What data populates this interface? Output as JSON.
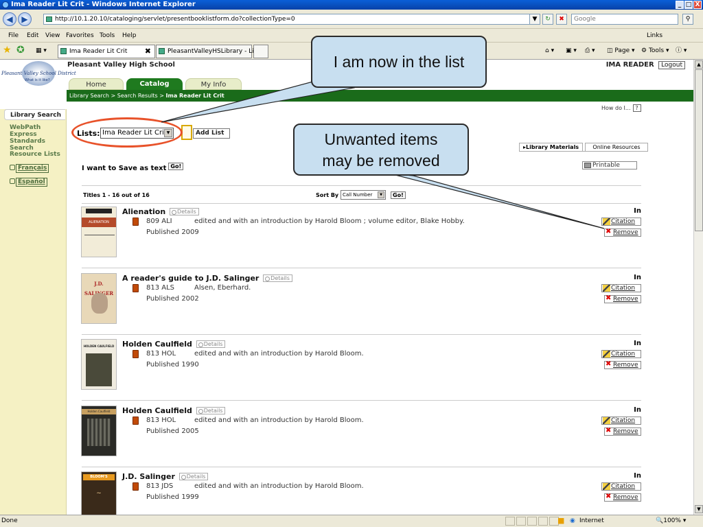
{
  "window": {
    "title": "Ima Reader Lit Crit - Windows Internet Explorer",
    "buttons": [
      "_",
      "□",
      "X"
    ]
  },
  "addressbar": {
    "url": "http://10.1.20.10/cataloging/servlet/presentbooklistform.do?collectionType=0",
    "search_placeholder": "Google"
  },
  "menu": {
    "items": [
      "File",
      "Edit",
      "View",
      "Favorites",
      "Tools",
      "Help"
    ],
    "links": "Links"
  },
  "browser_tabs": [
    {
      "label": "Ima Reader Lit Crit",
      "close": "✖"
    },
    {
      "label": "PleasantValleyHSLibrary - Lit..."
    }
  ],
  "toolbar": {
    "page": "Page",
    "tools": "Tools"
  },
  "status": {
    "left": "Done",
    "zone": "Internet",
    "zoom": "100%"
  },
  "site": {
    "logo_name": "Pleasant Valley School District",
    "logo_sub": "What is it like?",
    "school": "Pleasant Valley High School",
    "user": "IMA READER",
    "logout": "Logout"
  },
  "nav_tabs": [
    "Home",
    "Catalog",
    "My Info"
  ],
  "breadcrumb": {
    "path": "Library Search > Search Results > ",
    "current": "Ima Reader Lit Crit"
  },
  "sidebar": {
    "items": [
      "Library Search",
      "WebPath Express",
      "Standards Search",
      "Resource Lists"
    ],
    "languages": [
      "Français",
      "Español"
    ]
  },
  "help": {
    "label": "How do I...",
    "icon": "?"
  },
  "lists": {
    "label": "Lists:",
    "selected": "Ima Reader Lit Crit",
    "add_button": "Add List"
  },
  "result_tabs": [
    "Library Materials",
    "Online Resources"
  ],
  "save": {
    "label": "I want to Save as text",
    "go": "Go!"
  },
  "printable": "Printable",
  "results": {
    "count": "Titles 1 - 16 out of 16",
    "sort_label": "Sort By",
    "sort_selected": "Call Number",
    "sort_go": "Go!"
  },
  "item_labels": {
    "details": "Details",
    "citation": "Citation",
    "remove": "Remove"
  },
  "items": [
    {
      "title": "Alienation",
      "callno": "809 ALI",
      "author": "edited and with an introduction by Harold Bloom ; volume editor, Blake Hobby.",
      "published": "Published 2009",
      "status": "In",
      "cover_text": "ALIENATION"
    },
    {
      "title": "A reader's guide to J.D. Salinger",
      "callno": "813 ALS",
      "author": "Alsen, Eberhard.",
      "published": "Published 2002",
      "status": "In",
      "cover_text": "J.D. SALINGER"
    },
    {
      "title": "Holden Caulfield",
      "callno": "813 HOL",
      "author": "edited and with an introduction by Harold Bloom.",
      "published": "Published 1990",
      "status": "In",
      "cover_text": "HOLDEN CAULFIELD"
    },
    {
      "title": "Holden Caulfield",
      "callno": "813 HOL",
      "author": "edited and with an introduction by Harold Bloom.",
      "published": "Published 2005",
      "status": "In",
      "cover_text": "Holden Caulfield"
    },
    {
      "title": "J.D. Salinger",
      "callno": "813 JDS",
      "author": "edited and with an introduction by Harold Bloom.",
      "published": "Published 1999",
      "status": "In",
      "cover_text": "BLOOM'S"
    }
  ],
  "callouts": {
    "list": "I am now in the list",
    "remove_line1": "Unwanted items",
    "remove_line2": "may be removed"
  },
  "colors": {
    "green": "#1a6b1a",
    "callout": "#c8dff0",
    "ellipse": "#e8522a"
  }
}
